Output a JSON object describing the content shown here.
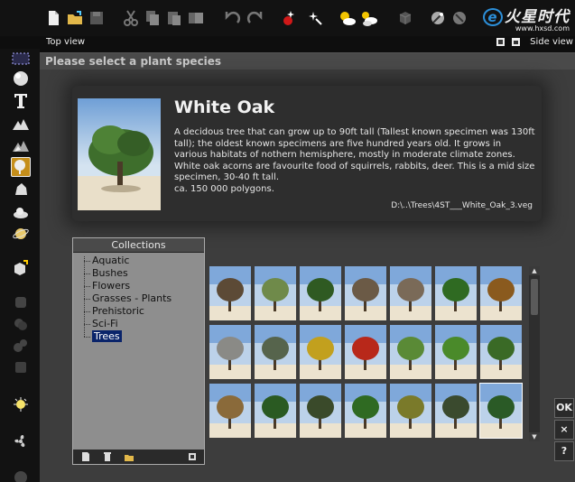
{
  "watermark": {
    "logo": "火星时代",
    "url": "www.hxsd.com"
  },
  "views": {
    "left": "Top view",
    "right": "Side view"
  },
  "dialog": {
    "title": "Please select a plant species",
    "plant": {
      "name": "White Oak",
      "description": "A decidous tree that can grow up to 90ft tall (Tallest known specimen was 130ft tall); the oldest known specimens are five hundred years old. It grows in various habitats of nothern hemisphere, mostly in moderate climate zones. White oak acorns are favourite food of squirrels, rabbits, deer. This is a mid size specimen, 30-40 ft tall.",
      "polygons": "ca. 150 000 polygons.",
      "path": "D:\\..\\Trees\\4ST___White_Oak_3.veg"
    },
    "collections": {
      "header": "Collections",
      "items": [
        "Aquatic",
        "Bushes",
        "Flowers",
        "Grasses - Plants",
        "Prehistoric",
        "Sci-Fi",
        "Trees"
      ],
      "selected": "Trees"
    },
    "thumbnails": [
      "dead-tree",
      "bush",
      "tall-conifer",
      "bare-tree",
      "bare-spreading-tree",
      "green-acacia",
      "autumn-acacia",
      "bare-grey-tree",
      "grey-oak",
      "yellow-tree",
      "red-tree",
      "flat-acacia",
      "willow",
      "palm",
      "tall-palm",
      "round-tree",
      "wide-oak",
      "tall-tree",
      "autumn-tree",
      "dark-tree",
      "white-oak"
    ],
    "selected_thumbnail": "white-oak",
    "buttons": {
      "ok": "OK",
      "cancel": "×",
      "help": "?"
    }
  },
  "colors": {
    "dialog_bg": "#3d3d3d",
    "selection": "#0a246a",
    "accent_blue": "#2c8fd9"
  }
}
